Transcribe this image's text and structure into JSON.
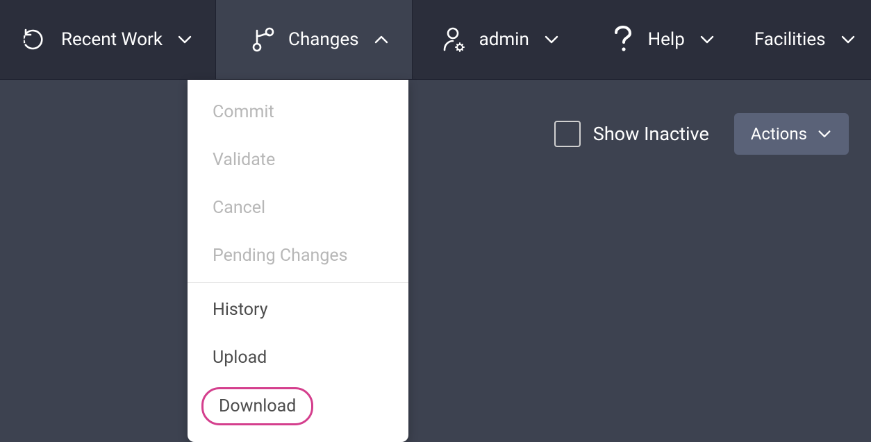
{
  "nav": {
    "recent_work": {
      "label": "Recent Work"
    },
    "changes": {
      "label": "Changes"
    },
    "admin": {
      "label": "admin"
    },
    "help": {
      "label": "Help"
    },
    "facilities": {
      "label": "Facilities"
    }
  },
  "changes_menu": {
    "commit": "Commit",
    "validate": "Validate",
    "cancel": "Cancel",
    "pending": "Pending Changes",
    "history": "History",
    "upload": "Upload",
    "download": "Download"
  },
  "toolbar": {
    "show_inactive": "Show Inactive",
    "actions": "Actions"
  }
}
